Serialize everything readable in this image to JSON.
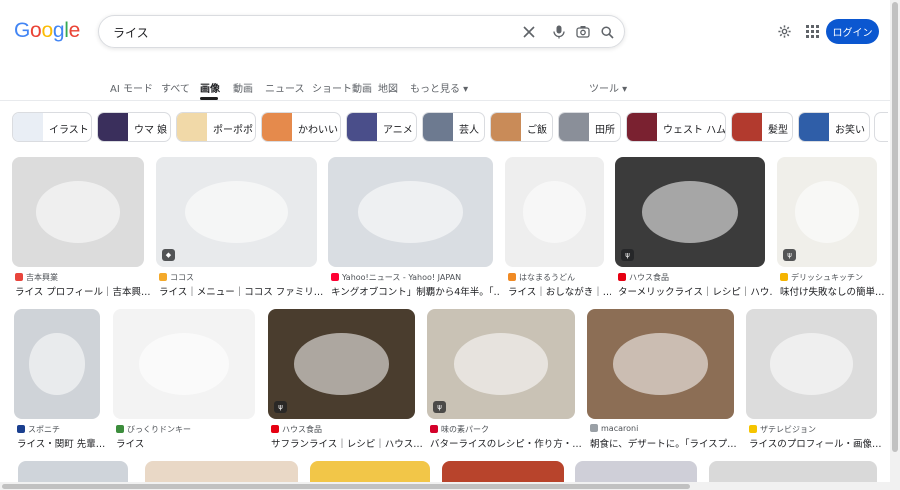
{
  "header": {
    "logo_letters": [
      {
        "ch": "G",
        "color": "#4285f4"
      },
      {
        "ch": "o",
        "color": "#ea4335"
      },
      {
        "ch": "o",
        "color": "#fbbc05"
      },
      {
        "ch": "g",
        "color": "#4285f4"
      },
      {
        "ch": "l",
        "color": "#34a853"
      },
      {
        "ch": "e",
        "color": "#ea4335"
      }
    ],
    "search_value": "ライス",
    "login_label": "ログイン"
  },
  "tabs": [
    {
      "label": "AI モード"
    },
    {
      "label": "すべて"
    },
    {
      "label": "画像"
    },
    {
      "label": "動画"
    },
    {
      "label": "ニュース"
    },
    {
      "label": "ショート動画"
    },
    {
      "label": "地図"
    },
    {
      "label": "もっと見る ▾"
    }
  ],
  "tools_label": "ツール ▾",
  "chips": [
    {
      "label": "イラスト",
      "thumb": "#e9eef5"
    },
    {
      "label": "ウマ 娘",
      "thumb": "#3a2f5c"
    },
    {
      "label": "ポーポポ",
      "thumb": "#f1d9a8"
    },
    {
      "label": "かわいい",
      "thumb": "#e58a4c"
    },
    {
      "label": "アニメ",
      "thumb": "#4a4e8a"
    },
    {
      "label": "芸人",
      "thumb": "#6d7a90"
    },
    {
      "label": "ご飯",
      "thumb": "#c98b58"
    },
    {
      "label": "田所",
      "thumb": "#8a8f99"
    },
    {
      "label": "ウェスト ハム",
      "thumb": "#7a2130"
    },
    {
      "label": "髪型",
      "thumb": "#b23a2e"
    },
    {
      "label": "お笑い",
      "thumb": "#2f5ea8"
    }
  ],
  "results": [
    {
      "source": "吉本興業",
      "title": "ライス プロフィール｜吉本興…",
      "fav": "#e8453c",
      "img": "#dcdcdc",
      "badge": ""
    },
    {
      "source": "ココス",
      "title": "ライス｜メニュー｜ココス ファミリ…",
      "fav": "#f4a92a",
      "img": "#e8eaec",
      "badge": "◆"
    },
    {
      "source": "Yahoo!ニュース - Yahoo! JAPAN",
      "title": "キングオブコント」制覇から4年半。「…",
      "fav": "#ff0033",
      "img": "#d9dde2",
      "badge": ""
    },
    {
      "source": "はなまるうどん",
      "title": "ライス｜おしながき｜…",
      "fav": "#f08a24",
      "img": "#eeeeee",
      "badge": ""
    },
    {
      "source": "ハウス食品",
      "title": "ターメリックライス｜レシピ｜ハウ…",
      "fav": "#e60012",
      "img": "#3b3b3b",
      "badge": "ψ"
    },
    {
      "source": "デリッシュキッチン",
      "title": "味付け失敗なしの簡単…",
      "fav": "#f5b400",
      "img": "#f0efea",
      "badge": "ψ"
    },
    {
      "source": "スポニチ",
      "title": "ライス・関町 先輩…",
      "fav": "#1a3f8f",
      "img": "#cfd3d8",
      "badge": ""
    },
    {
      "source": "びっくりドンキー",
      "title": "ライス",
      "fav": "#3c8d3c",
      "img": "#f3f3f3",
      "badge": ""
    },
    {
      "source": "ハウス食品",
      "title": "サフランライス｜レシピ｜ハウス…",
      "fav": "#e60012",
      "img": "#4a3d2e",
      "badge": "ψ"
    },
    {
      "source": "味の素パーク",
      "title": "バターライスのレシピ・作り方・…",
      "fav": "#d4002a",
      "img": "#c9c2b5",
      "badge": "ψ"
    },
    {
      "source": "macaroni",
      "title": "朝食に、デザートに。「ライスプ…",
      "fav": "#9aa0a6",
      "img": "#8c6e55",
      "badge": ""
    },
    {
      "source": "ザテレビジョン",
      "title": "ライスのプロフィール・画像…",
      "fav": "#f5c400",
      "img": "#dcdcdc",
      "badge": ""
    }
  ],
  "third_row_colors": [
    "#cfd4da",
    "#e9d8c6",
    "#f2c648",
    "#b8442c",
    "#cfcfd8",
    "#d9d9d9"
  ]
}
